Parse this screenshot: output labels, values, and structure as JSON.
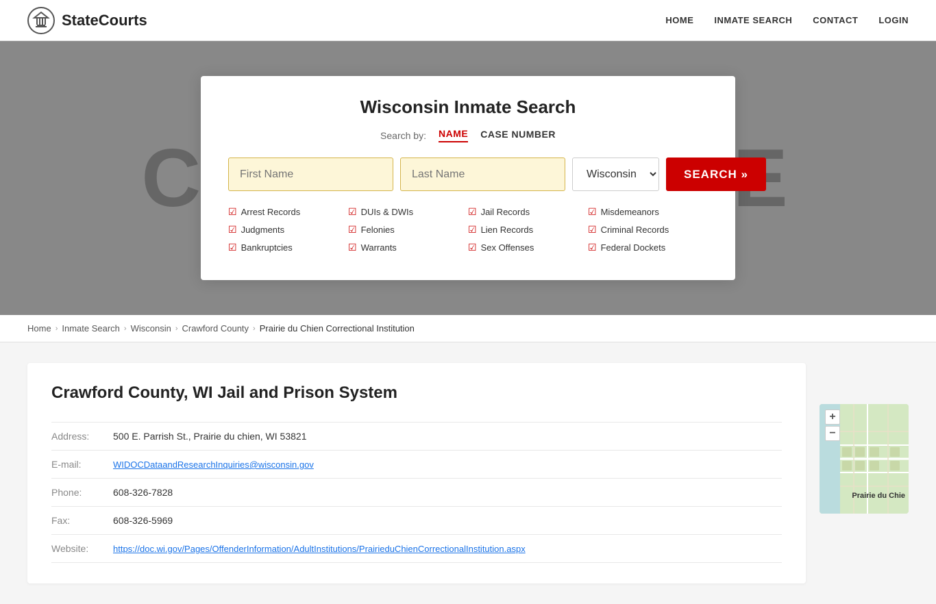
{
  "header": {
    "logo_text": "StateCourts",
    "nav": {
      "home": "HOME",
      "inmate_search": "INMATE SEARCH",
      "contact": "CONTACT",
      "login": "LOGIN"
    }
  },
  "hero": {
    "bg_text": "COURTHOUSE"
  },
  "search_card": {
    "title": "Wisconsin Inmate Search",
    "search_by_label": "Search by:",
    "tab_name": "NAME",
    "tab_case": "CASE NUMBER",
    "first_name_placeholder": "First Name",
    "last_name_placeholder": "Last Name",
    "state_value": "Wisconsin",
    "search_button": "SEARCH »",
    "checkboxes": [
      {
        "label": "Arrest Records"
      },
      {
        "label": "DUIs & DWIs"
      },
      {
        "label": "Jail Records"
      },
      {
        "label": "Misdemeanors"
      },
      {
        "label": "Judgments"
      },
      {
        "label": "Felonies"
      },
      {
        "label": "Lien Records"
      },
      {
        "label": "Criminal Records"
      },
      {
        "label": "Bankruptcies"
      },
      {
        "label": "Warrants"
      },
      {
        "label": "Sex Offenses"
      },
      {
        "label": "Federal Dockets"
      }
    ]
  },
  "breadcrumb": {
    "home": "Home",
    "inmate_search": "Inmate Search",
    "wisconsin": "Wisconsin",
    "crawford_county": "Crawford County",
    "current": "Prairie du Chien Correctional Institution"
  },
  "main": {
    "title": "Crawford County, WI Jail and Prison System",
    "address_label": "Address:",
    "address_value": "500 E. Parrish St., Prairie du chien, WI 53821",
    "email_label": "E-mail:",
    "email_value": "WIDOCDataandResearchInquiries@wisconsin.gov",
    "phone_label": "Phone:",
    "phone_value": "608-326-7828",
    "fax_label": "Fax:",
    "fax_value": "608-326-5969",
    "website_label": "Website:",
    "website_value": "https://doc.wi.gov/Pages/OffenderInformation/AdultInstitutions/PrairieduChienCorrectionalInstitution.aspx"
  },
  "map": {
    "plus": "+",
    "minus": "−",
    "label": "Prairie du Chie"
  }
}
